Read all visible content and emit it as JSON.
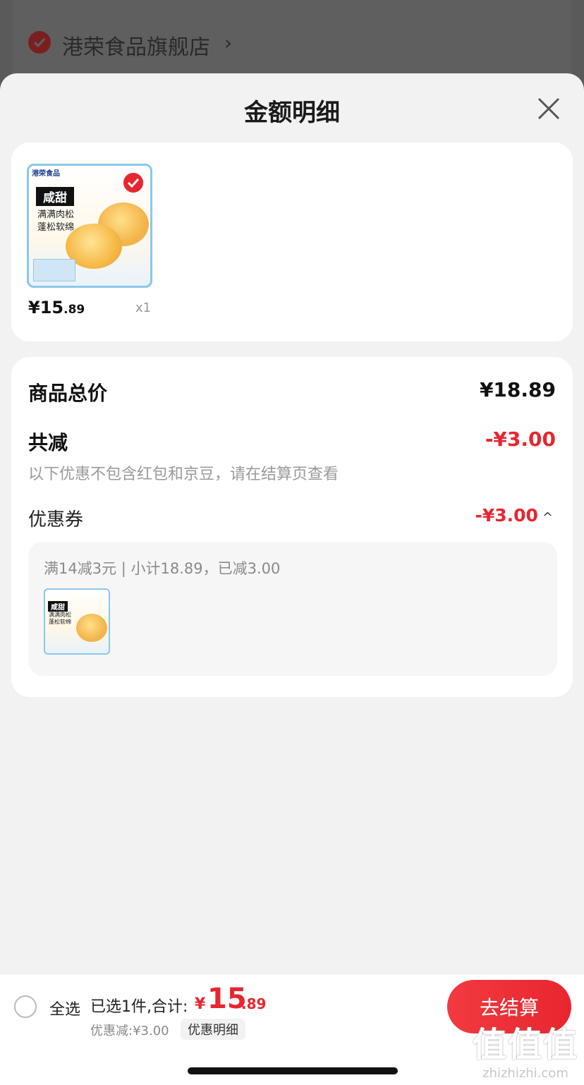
{
  "background": {
    "store_name": "港荣食品旗舰店",
    "chevron": "›"
  },
  "sheet": {
    "title": "金额明细",
    "close_icon": "close-icon"
  },
  "product": {
    "image_brand": "港荣食品",
    "image_tag": "咸甜",
    "image_line1": "满满肉松",
    "image_line2": "蓬松软绵",
    "price_int": "¥15",
    "price_dec": ".89",
    "qty": "x1",
    "selected": true
  },
  "summary": {
    "total_label": "商品总价",
    "total_value": "¥18.89",
    "reduce_label": "共减",
    "reduce_value": "-¥3.00",
    "note": "以下优惠不包含红包和京豆，请在结算页查看",
    "coupon_label": "优惠券",
    "coupon_value": "-¥3.00",
    "coupon_caret": "^",
    "coupon_info": "满14减3元 | 小计18.89，已减3.00"
  },
  "bottom": {
    "select_all": "全选",
    "selected_text": "已选1件,合计:",
    "total_yen": "¥",
    "total_int": "15",
    "total_dec": ".89",
    "discount_text": "优惠减:¥3.00",
    "detail_label": "优惠明细",
    "checkout_label": "去结算"
  },
  "watermark": {
    "big": "值值值",
    "small": "zhizhizhi.com"
  },
  "colors": {
    "accent": "#e8262f",
    "sheet_bg": "#f2f2f2",
    "overlay": "#5a5a5a"
  }
}
